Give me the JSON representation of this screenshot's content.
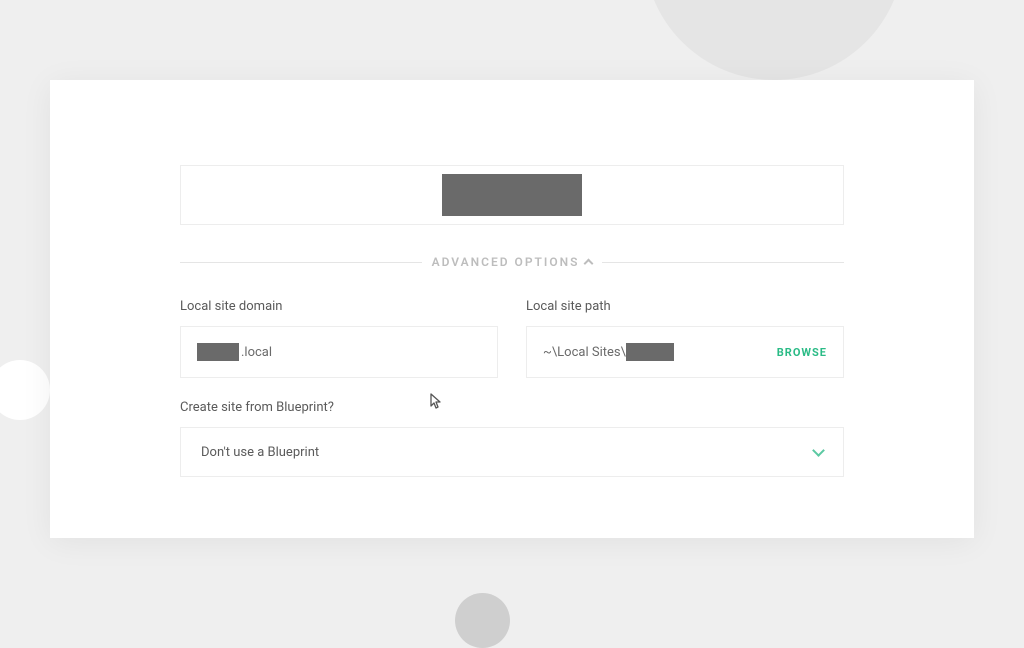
{
  "siteName": {
    "value_redacted": true
  },
  "advancedToggle": {
    "label": "ADVANCED OPTIONS"
  },
  "domain": {
    "label": "Local site domain",
    "prefix_redacted": true,
    "suffix": ".local"
  },
  "path": {
    "label": "Local site path",
    "prefix": "~\\Local Sites\\",
    "suffix_redacted": true,
    "browseLabel": "BROWSE"
  },
  "blueprint": {
    "label": "Create site from Blueprint?",
    "selected": "Don't use a Blueprint"
  }
}
